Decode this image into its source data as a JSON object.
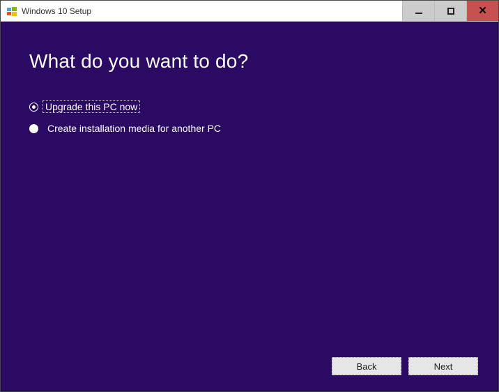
{
  "window": {
    "title": "Windows 10 Setup"
  },
  "main": {
    "heading": "What do you want to do?",
    "options": [
      {
        "label": "Upgrade this PC now",
        "selected": true
      },
      {
        "label": "Create installation media for another PC",
        "selected": false
      }
    ]
  },
  "footer": {
    "back_label": "Back",
    "next_label": "Next"
  }
}
